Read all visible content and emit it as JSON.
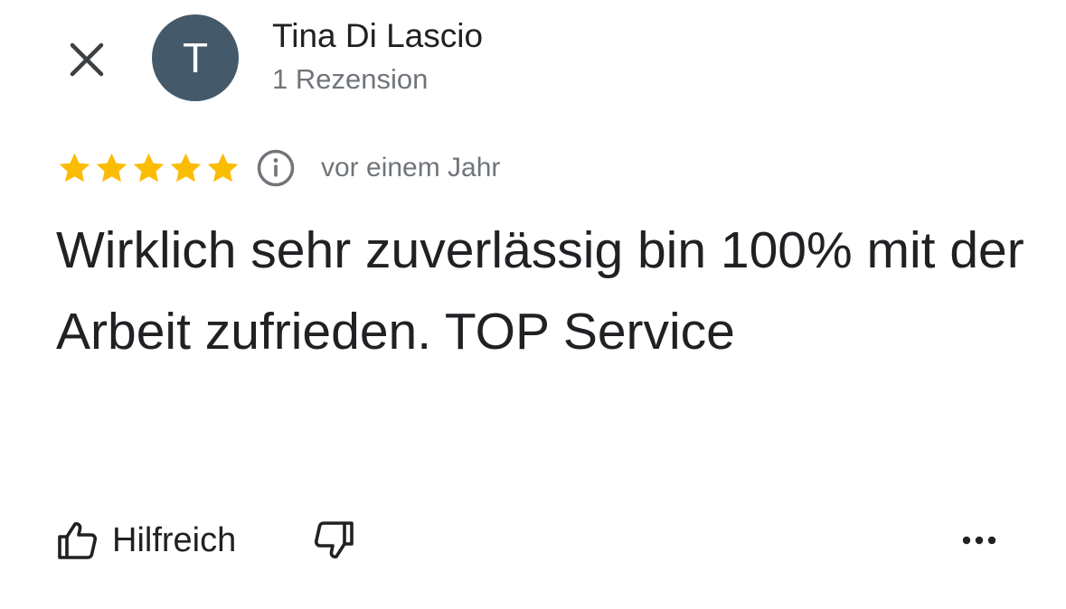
{
  "header": {
    "close_icon": "close-icon",
    "avatar_initial": "T",
    "avatar_color": "#445a6b",
    "reviewer_name": "Tina Di Lascio",
    "review_count": "1 Rezension"
  },
  "review": {
    "rating": 5,
    "max_rating": 5,
    "star_color": "#fbbc04",
    "info_icon": "info-icon",
    "date": "vor einem Jahr",
    "text": "Wirklich sehr zuverlässig bin 100% mit der Arbeit zufrieden. TOP Service"
  },
  "actions": {
    "helpful_icon": "thumbs-up-icon",
    "helpful_label": "Hilfreich",
    "unhelpful_icon": "thumbs-down-icon",
    "more_icon": "more-horizontal-icon"
  }
}
